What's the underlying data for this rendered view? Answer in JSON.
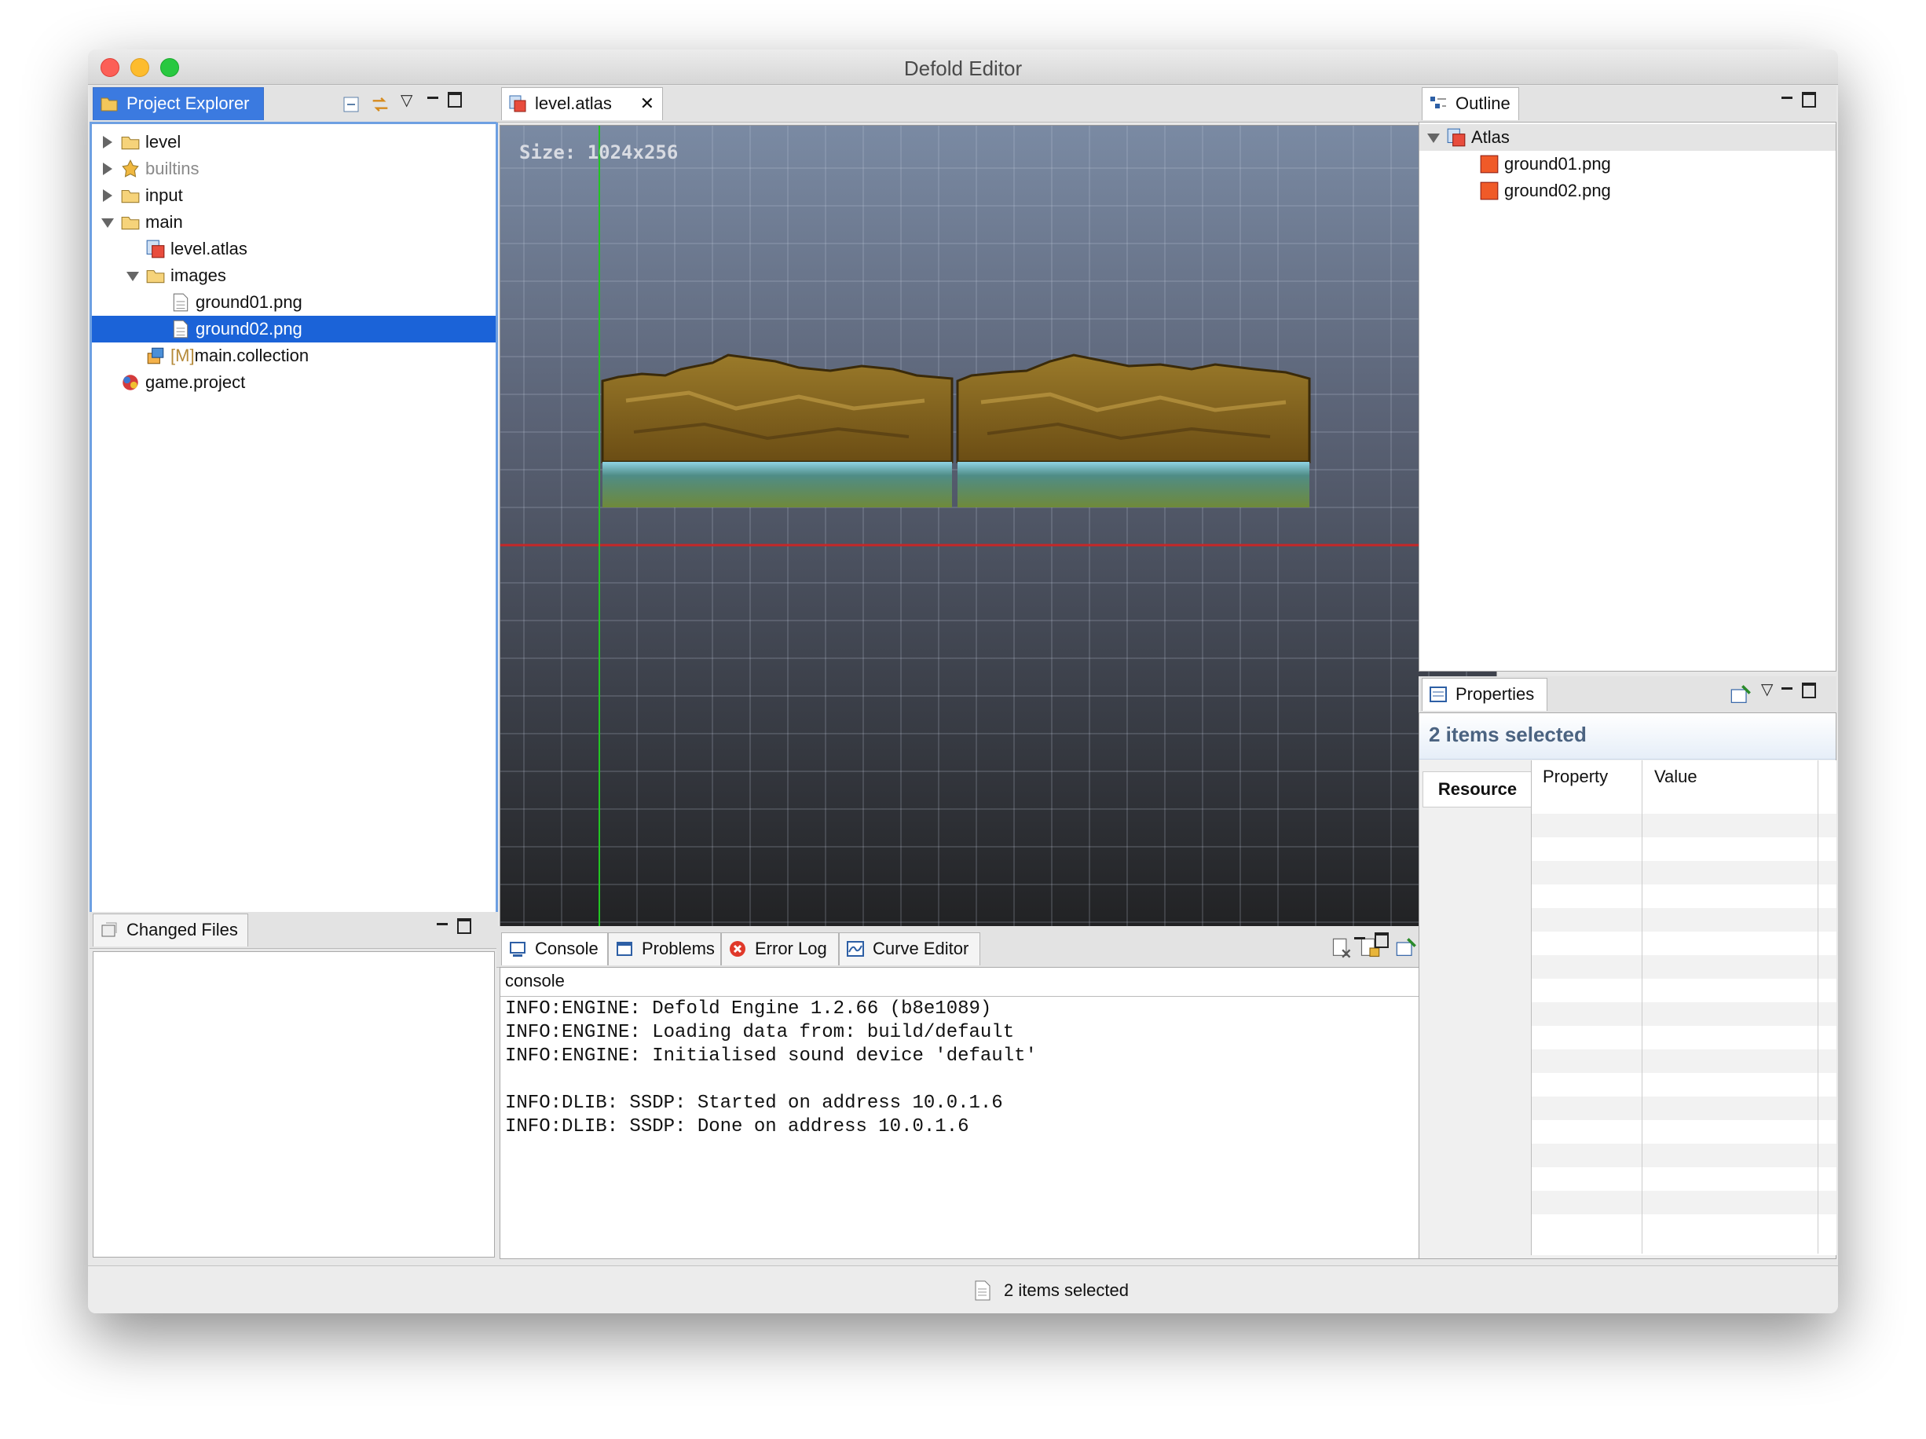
{
  "window": {
    "title": "Defold Editor"
  },
  "project_explorer": {
    "tab_label": "Project Explorer",
    "items": [
      {
        "label": "level",
        "type": "folder",
        "expanded": false,
        "depth": 0
      },
      {
        "label": "builtins",
        "type": "builtin",
        "expanded": false,
        "depth": 0
      },
      {
        "label": "input",
        "type": "folder",
        "expanded": false,
        "depth": 0
      },
      {
        "label": "main",
        "type": "folder",
        "expanded": true,
        "depth": 0
      },
      {
        "label": "level.atlas",
        "type": "atlas",
        "depth": 1
      },
      {
        "label": "images",
        "type": "folder",
        "expanded": true,
        "depth": 1
      },
      {
        "label": "ground01.png",
        "type": "file",
        "depth": 2
      },
      {
        "label": "ground02.png",
        "type": "file",
        "depth": 2,
        "selected": true
      },
      {
        "label": "main.collection",
        "prefix": "[M]",
        "type": "collection",
        "depth": 1
      },
      {
        "label": "game.project",
        "type": "project",
        "depth": 0
      }
    ]
  },
  "changed_files": {
    "tab_label": "Changed Files"
  },
  "editor": {
    "tab_label": "level.atlas",
    "size_label": "Size: 1024x256",
    "bg_top": "#7a8aa3",
    "bg_bottom": "#1c1c1c"
  },
  "outline": {
    "tab_label": "Outline",
    "root": "Atlas",
    "items": [
      "ground01.png",
      "ground02.png"
    ]
  },
  "properties": {
    "tab_label": "Properties",
    "heading": "2 items selected",
    "side_tab": "Resource",
    "columns": [
      "Property",
      "Value"
    ]
  },
  "console": {
    "tabs": [
      "Console",
      "Problems",
      "Error Log",
      "Curve Editor"
    ],
    "header": "console",
    "lines": [
      "INFO:ENGINE: Defold Engine 1.2.66 (b8e1089)",
      "INFO:ENGINE: Loading data from: build/default",
      "INFO:ENGINE: Initialised sound device 'default'",
      "",
      "INFO:DLIB: SSDP: Started on address 10.0.1.6",
      "INFO:DLIB: SSDP: Done on address 10.0.1.6"
    ]
  },
  "status_bar": {
    "text": "2 items selected"
  },
  "colors": {
    "selection": "#1b63d8",
    "active_tab": "#3b7ae0",
    "axis_x": "#c62828",
    "axis_y": "#22c522"
  }
}
